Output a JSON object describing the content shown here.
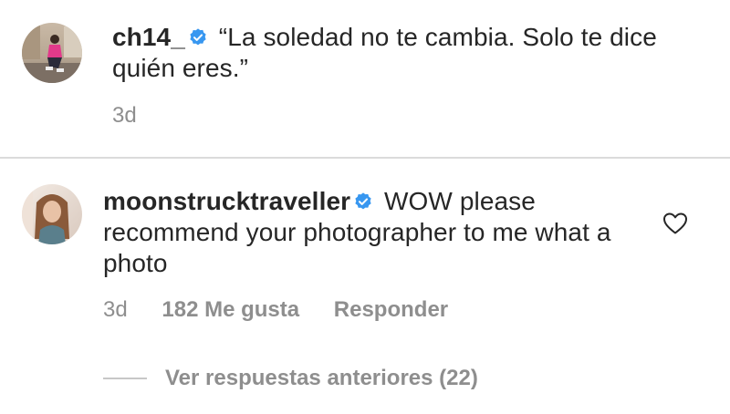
{
  "caption": {
    "username": "ch14_",
    "verified_icon": "verified-badge-icon",
    "text": "“La soledad no te cambia. Solo te dice quién eres.”",
    "time": "3d"
  },
  "comment": {
    "username": "moonstrucktraveller",
    "verified_icon": "verified-badge-icon",
    "text": "WOW please recommend your photographer to me what a photo",
    "time": "3d",
    "likes": "182 Me gusta",
    "reply_label": "Responder",
    "like_icon": "heart-outline-icon"
  },
  "replies": {
    "label": "Ver respuestas anteriores (22)"
  },
  "colors": {
    "text": "#262626",
    "muted": "#8e8e8e",
    "verified": "#3897f0",
    "divider": "#dbdbdb"
  }
}
